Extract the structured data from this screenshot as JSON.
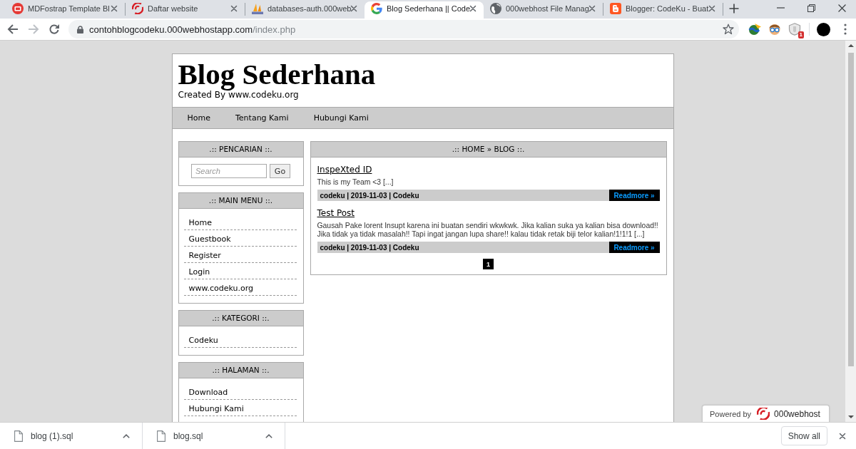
{
  "browser": {
    "tabs": [
      {
        "title": "MDFostrap Template Bl",
        "selected": false
      },
      {
        "title": "Daftar website",
        "selected": false
      },
      {
        "title": "databases-auth.000web",
        "selected": false
      },
      {
        "title": "Blog Sederhana || Code",
        "selected": true
      },
      {
        "title": "000webhost File Manag",
        "selected": false
      },
      {
        "title": "Blogger: CodeKu - Buat",
        "selected": false
      }
    ],
    "forward": {
      "disabled": true
    },
    "address": {
      "host": "contohblogcodeku.000webhostapp.com",
      "path": "/index.php"
    },
    "extension_badge": "1"
  },
  "site": {
    "title": "Blog Sederhana",
    "subtitle": "Created By www.codeku.org",
    "nav": [
      "Home",
      "Tentang Kami",
      "Hubungi Kami"
    ]
  },
  "sidebar": [
    {
      "kind": "search",
      "heading": ".:: PENCARIAN ::.",
      "placeholder": "Search",
      "button": "Go"
    },
    {
      "kind": "links",
      "heading": ".:: MAIN MENU ::.",
      "items": [
        "Home",
        "Guestbook",
        "Register",
        "Login",
        "www.codeku.org"
      ]
    },
    {
      "kind": "links",
      "heading": ".:: KATEGORI ::.",
      "items": [
        "Codeku"
      ]
    },
    {
      "kind": "links",
      "heading": ".:: HALAMAN ::.",
      "items": [
        "Download",
        "Hubungi Kami"
      ]
    }
  ],
  "main": {
    "heading": ".:: HOME » BLOG ::.",
    "posts": [
      {
        "title": "InspeXted ID",
        "excerpt": "This is my Team <3 [...]",
        "meta": "codeku | 2019-11-03 | Codeku",
        "readmore": "Readmore »"
      },
      {
        "title": "Test Post",
        "excerpt": "Gausah Pake lorent Insupt karena ini buatan sendiri wkwkwk. Jika kalian suka ya kalian bisa download!! Jika tidak ya tidak masalah!! Tapi ingat jangan lupa share!! kalau tidak retak biji telor kalian!1!1!1 [...]",
        "meta": "codeku | 2019-11-03 | Codeku",
        "readmore": "Readmore »"
      }
    ],
    "pages": [
      {
        "label": "1",
        "selected": true
      }
    ]
  },
  "powered_by": {
    "label": "Powered by",
    "brand": "000webhost"
  },
  "downloads": {
    "files": [
      "blog (1).sql",
      "blog.sql"
    ],
    "show_all": "Show all"
  }
}
